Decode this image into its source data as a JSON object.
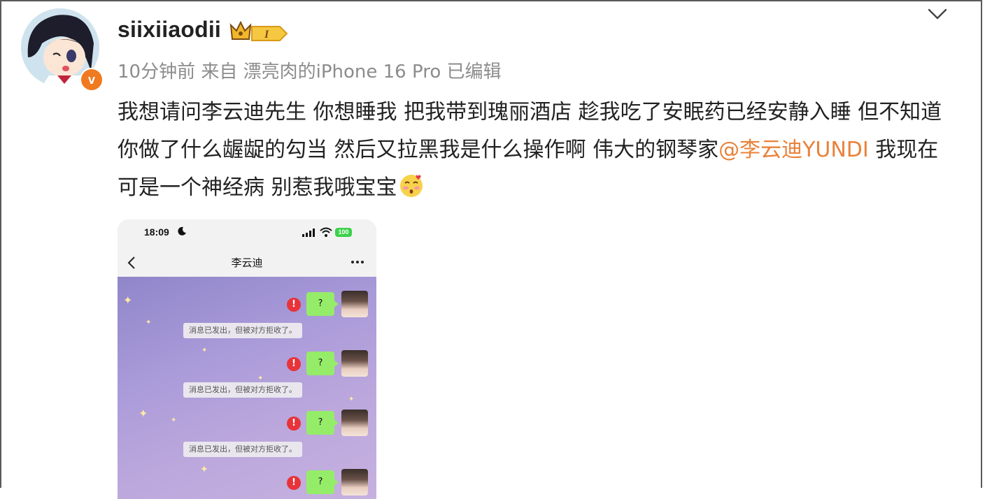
{
  "post": {
    "username": "siixiiaodii",
    "member_badge_label": "I",
    "verified_mark": "v",
    "meta": "10分钟前 来自 漂亮肉的iPhone 16 Pro 已编辑",
    "text_part1": "我想请问李云迪先生 你想睡我 把我带到瑰丽酒店 趁我吃了安眠药已经安静入睡 但不知道你做了什么龌龊的勾当  然后又拉黑我是什么操作啊 伟大的钢琴家",
    "mention": "@李云迪YUNDI",
    "text_part2": " 我现在可是一个神经病 别惹我哦宝宝",
    "emoji": "blushing-kiss-emoji",
    "menu_icon": "chevron-down-icon"
  },
  "screenshot": {
    "status_time": "18:09",
    "battery": "100",
    "chat_title": "李云迪",
    "messages": [
      {
        "bubble": "?",
        "error": "!"
      },
      {
        "bubble": "?",
        "error": "!"
      },
      {
        "bubble": "?",
        "error": "!"
      },
      {
        "bubble": "?",
        "error": "!"
      }
    ],
    "system_notes": [
      "消息已发出，但被对方拒收了。",
      "消息已发出，但被对方拒收了。",
      "消息已发出，但被对方拒收了。"
    ]
  },
  "colors": {
    "mention": "#e8823a",
    "meta_text": "#8c8c8c",
    "verified_badge": "#f07a1f",
    "bubble": "#95ec69",
    "error": "#e8333a"
  }
}
